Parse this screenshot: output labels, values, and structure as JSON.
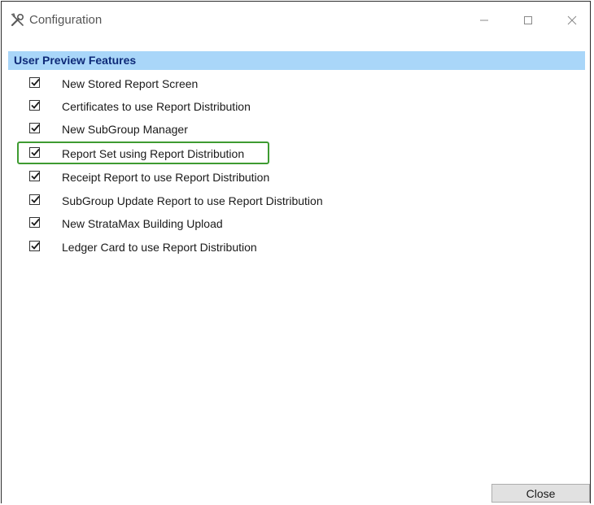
{
  "window": {
    "title": "Configuration",
    "controls": {
      "minimize_icon": "minimize-icon",
      "maximize_icon": "maximize-icon",
      "close_icon": "close-icon"
    }
  },
  "section": {
    "title": "User Preview Features",
    "header_color": "#a9d6f9",
    "title_color": "#0e2a78"
  },
  "features": [
    {
      "label": "New Stored Report Screen",
      "checked": true
    },
    {
      "label": "Certificates to use Report Distribution",
      "checked": true
    },
    {
      "label": "New SubGroup Manager",
      "checked": true
    },
    {
      "label": "Report Set using Report Distribution",
      "checked": true,
      "highlighted": true
    },
    {
      "label": "Receipt Report to use Report Distribution",
      "checked": true
    },
    {
      "label": "SubGroup Update Report to use Report Distribution",
      "checked": true
    },
    {
      "label": "New StrataMax Building Upload",
      "checked": true
    },
    {
      "label": "Ledger Card to use Report Distribution",
      "checked": true
    }
  ],
  "highlight_color": "#3e9b31",
  "footer": {
    "close_label": "Close"
  }
}
